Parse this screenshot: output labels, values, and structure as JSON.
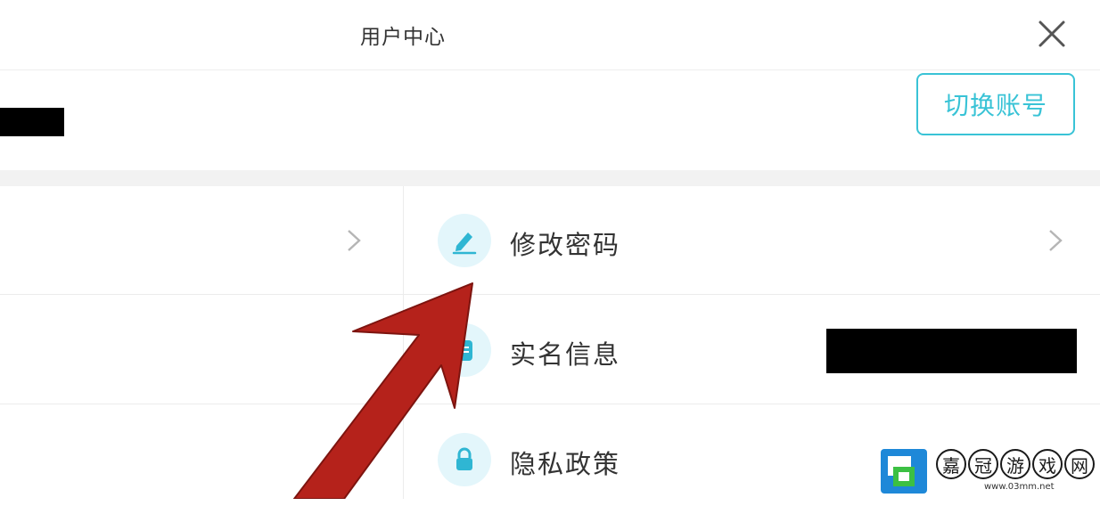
{
  "header": {
    "title": "用户中心",
    "close_icon": "close-icon"
  },
  "account": {
    "switch_label": "切换账号"
  },
  "menu": {
    "right_items": [
      {
        "label": "修改密码",
        "icon": "pencil-icon"
      },
      {
        "label": "实名信息",
        "icon": "document-icon"
      },
      {
        "label": "隐私政策",
        "icon": "lock-icon"
      }
    ]
  },
  "colors": {
    "accent": "#39c3d6",
    "icon_bg": "#e3f6fb",
    "arrow": "#b5221b"
  },
  "watermark": {
    "chars": [
      "嘉",
      "冠",
      "游",
      "戏",
      "网"
    ],
    "url": "www.03mm.net"
  }
}
